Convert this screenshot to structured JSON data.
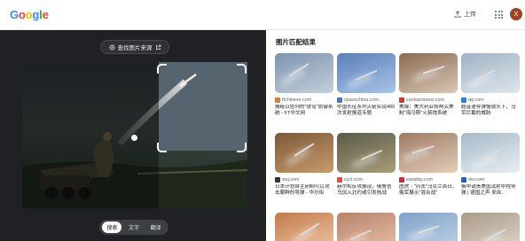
{
  "header": {
    "logo_letters": [
      {
        "char": "G",
        "color": "#4285F4"
      },
      {
        "char": "o",
        "color": "#EA4335"
      },
      {
        "char": "o",
        "color": "#FBBC05"
      },
      {
        "char": "g",
        "color": "#4285F4"
      },
      {
        "char": "l",
        "color": "#34A853"
      },
      {
        "char": "e",
        "color": "#EA4335"
      }
    ],
    "upload_label": "上传",
    "upload_icon": "upload-icon",
    "apps_icon": "apps-grid-icon",
    "avatar_letter": "X"
  },
  "viewer": {
    "source_button_label": "查找图片来源",
    "modes": [
      {
        "label": "搜索",
        "active": true
      },
      {
        "label": "文字",
        "active": false
      },
      {
        "label": "翻译",
        "active": false
      }
    ]
  },
  "results": {
    "title": "图片匹配结果",
    "items": [
      {
        "source": "ftchinese.com",
        "fav_color": "#d9822b",
        "desc": "揭秘以色列的\"铁穹\"防御系统 - FT中文网",
        "bg": [
          "#7f93ad",
          "#c2cfdc"
        ]
      },
      {
        "source": "spacechina.com",
        "fav_color": "#4a76c8",
        "desc": "中国长征系列火箭实现400次发射报道专题",
        "bg": [
          "#5a7fb8",
          "#a8c4e6"
        ]
      },
      {
        "source": "cankaoxiaoxi.com",
        "fav_color": "#d23b2f",
        "desc": "美媒：美大利亚将购买美制\"海马斯\"火箭炮系统",
        "bg": [
          "#8a6a52",
          "#d8c6b4"
        ]
      },
      {
        "source": "qq.com",
        "fav_color": "#2a7fe0",
        "desc": "超音速导弹慢镜头下，乌军拦截的威胁",
        "bg": [
          "#9fb2c4",
          "#dfe6ec"
        ]
      },
      {
        "source": "wsj.com",
        "fav_color": "#333333",
        "desc": "日本计划自主研制可以攻击朝鲜的导弹 - 华尔街",
        "bg": [
          "#7a5a3a",
          "#c89a6a"
        ]
      },
      {
        "source": "cycl.com",
        "fav_color": "#e0503a",
        "desc": "赫尔松反攻展现，俄警告乌加入北约或引发核战",
        "bg": [
          "#5b5a48",
          "#a89e7a"
        ]
      },
      {
        "source": "eastday.com",
        "fav_color": "#c8312b",
        "desc": "图虎｜\"闪击\"乌克兰首日，俄军展示\"混合战\"",
        "bg": [
          "#9c7a64",
          "#e4cdb8"
        ]
      },
      {
        "source": "dw.com",
        "fav_color": "#1f63b5",
        "desc": "俄中谴责美国试射中程导弹 | 德国之声 来自...",
        "bg": [
          "#a6b9c9",
          "#e9eef2"
        ]
      },
      {
        "source": "",
        "fav_color": "#ffffff",
        "desc": "",
        "bg": [
          "#c47a4a",
          "#ecc9a8"
        ]
      },
      {
        "source": "",
        "fav_color": "#ffffff",
        "desc": "",
        "bg": [
          "#b8826a",
          "#e8c2aa"
        ]
      },
      {
        "source": "",
        "fav_color": "#ffffff",
        "desc": "",
        "bg": [
          "#7fa0c8",
          "#c4d6ea"
        ]
      },
      {
        "source": "",
        "fav_color": "#ffffff",
        "desc": "",
        "bg": [
          "#aa9a88",
          "#e2d8cc"
        ]
      }
    ]
  }
}
